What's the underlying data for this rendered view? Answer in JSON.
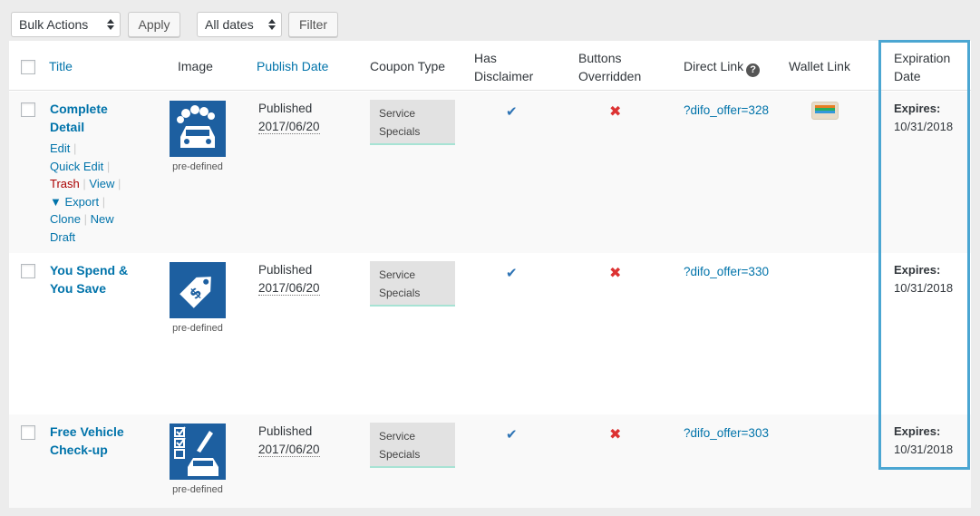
{
  "toolbar": {
    "bulk_actions": "Bulk Actions",
    "apply": "Apply",
    "all_dates": "All dates",
    "filter": "Filter"
  },
  "columns": {
    "title": "Title",
    "image": "Image",
    "publish_date": "Publish Date",
    "coupon_type": "Coupon Type",
    "has_disclaimer": [
      "Has",
      "Disclaimer"
    ],
    "buttons_overridden": [
      "Buttons",
      "Overridden"
    ],
    "direct_link": "Direct Link",
    "direct_link_help": "?",
    "wallet_link": "Wallet Link",
    "expiration_date": [
      "Expiration",
      "Date"
    ]
  },
  "row_actions": {
    "edit": "Edit",
    "quick_edit": "Quick Edit",
    "trash": "Trash",
    "view": "View",
    "export": "▼ Export",
    "clone": "Clone",
    "new_draft": "New Draft",
    "separator": "|"
  },
  "rows": [
    {
      "title": [
        "Complete",
        "Detail"
      ],
      "image_caption": "pre-defined",
      "status": "Published",
      "date": "2017/06/20",
      "coupon_type": [
        "Service",
        "Specials"
      ],
      "has_disclaimer": "✔",
      "buttons_overridden": "✖",
      "direct_link": "?difo_offer=328",
      "wallet": true,
      "expires_label": "Expires:",
      "expires_date": "10/31/2018"
    },
    {
      "title": [
        "You Spend &",
        "You Save"
      ],
      "image_caption": "pre-defined",
      "status": "Published",
      "date": "2017/06/20",
      "coupon_type": [
        "Service",
        "Specials"
      ],
      "has_disclaimer": "✔",
      "buttons_overridden": "✖",
      "direct_link": "?difo_offer=330",
      "wallet": false,
      "expires_label": "Expires:",
      "expires_date": "10/31/2018"
    },
    {
      "title": [
        "Free Vehicle",
        "Check-up"
      ],
      "image_caption": "pre-defined",
      "status": "Published",
      "date": "2017/06/20",
      "coupon_type": [
        "Service",
        "Specials"
      ],
      "has_disclaimer": "✔",
      "buttons_overridden": "✖",
      "direct_link": "?difo_offer=303",
      "wallet": false,
      "expires_label": "Expires:",
      "expires_date": "10/31/2018"
    }
  ],
  "colors": {
    "link": "#0073aa",
    "trash": "#aa0000",
    "check": "#2e74b5",
    "cross": "#dc3232",
    "highlight": "#4ba6d2"
  }
}
